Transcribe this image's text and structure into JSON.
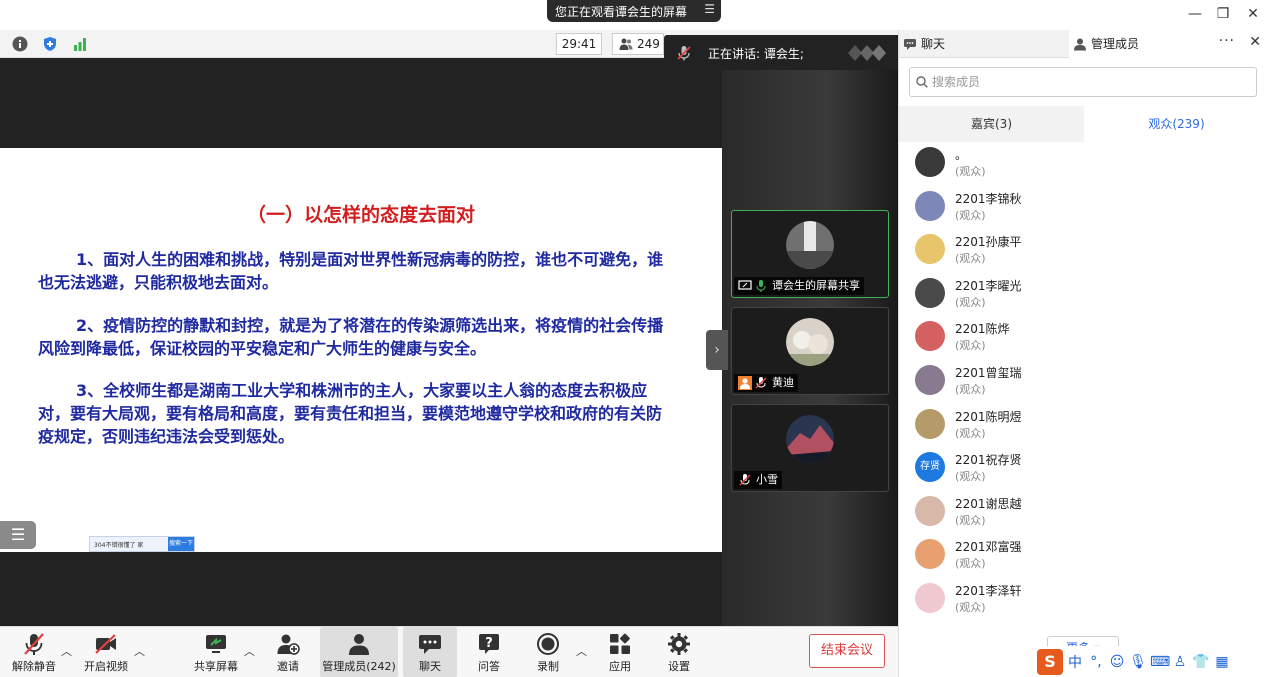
{
  "window": {
    "share_banner": "您正在观看谭会生的屏幕",
    "minimize": "—",
    "restore": "❐",
    "close": "✕"
  },
  "infobar": {
    "timer": "29:41",
    "participant_count": "249"
  },
  "speaking": {
    "text": "正在讲话: 谭会生;"
  },
  "slide": {
    "title": "（一）以怎样的态度去面对",
    "paragraphs": [
      "1、面对人生的困难和挑战，特别是面对世界性新冠病毒的防控，谁也不可避免，谁也无法逃避，只能积极地去面对。",
      "2、疫情防控的静默和封控，就是为了将潜在的传染源筛选出来，将疫情的社会传播风险到降最低，保证校园的平安稳定和广大师生的健康与安全。",
      "3、全校师生都是湖南工业大学和株洲市的主人，大家要以主人翁的态度去积极应对，要有大局观，要有格局和高度，要有责任和担当，要模范地遵守学校和政府的有关防疫规定，否则违纪违法会受到惩处。"
    ],
    "taskbar_text": "304不错很懂了 家",
    "taskbar_button": "搜索一下"
  },
  "videos": [
    {
      "label": "谭会生的屏幕共享"
    },
    {
      "label": "黄迪"
    },
    {
      "label": "小雪"
    }
  ],
  "panel": {
    "tab_chat": "聊天",
    "tab_members": "管理成员",
    "more": "···",
    "close": "✕",
    "search_placeholder": "搜索成员",
    "subtab_guests": "嘉宾(3)",
    "subtab_audience": "观众(239)",
    "members": [
      {
        "name": "。",
        "role": "(观众)",
        "color": "#3a3a3a"
      },
      {
        "name": "2201李锦秋",
        "role": "(观众)",
        "color": "#7d87b8"
      },
      {
        "name": "2201孙康平",
        "role": "(观众)",
        "color": "#e8c46a"
      },
      {
        "name": "2201李曜光",
        "role": "(观众)",
        "color": "#4a4a4a"
      },
      {
        "name": "2201陈烨",
        "role": "(观众)",
        "color": "#d46060"
      },
      {
        "name": "2201曾玺瑞",
        "role": "(观众)",
        "color": "#8a7a90"
      },
      {
        "name": "2201陈明煜",
        "role": "(观众)",
        "color": "#b59a6a"
      },
      {
        "name": "2201祝存贤",
        "role": "(观众)",
        "color": "#1e7ae0",
        "initials": "存贤"
      },
      {
        "name": "2201谢思越",
        "role": "(观众)",
        "color": "#d8b8a8"
      },
      {
        "name": "2201邓富强",
        "role": "(观众)",
        "color": "#e8a070"
      },
      {
        "name": "2201李泽轩",
        "role": "(观众)",
        "color": "#f0c8d0"
      }
    ],
    "more_button": "更多 ▾"
  },
  "ime": {
    "logo": "S",
    "mode": "中"
  },
  "toolbar": {
    "mute": "解除静音",
    "video": "开启视频",
    "share": "共享屏幕",
    "invite": "邀请",
    "members": "管理成员(242)",
    "chat": "聊天",
    "qa": "问答",
    "record": "录制",
    "apps": "应用",
    "settings": "设置",
    "end": "结束会议"
  }
}
